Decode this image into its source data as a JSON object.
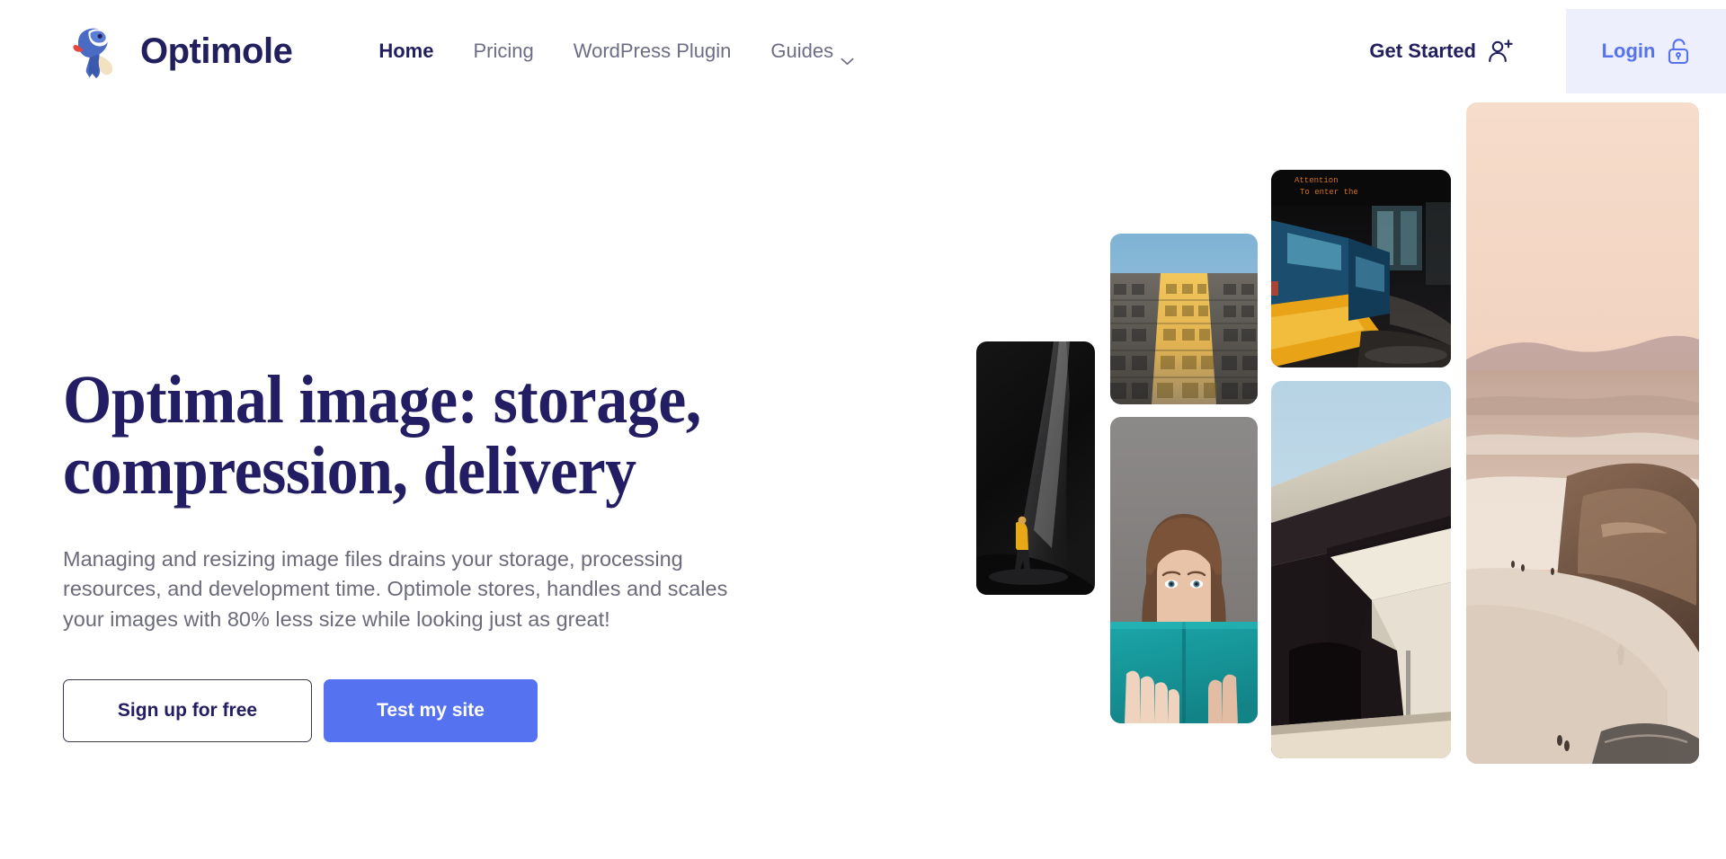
{
  "brand": {
    "name": "Optimole",
    "logo_icon": "optimole-mole-logo",
    "navy": "#221F5E",
    "blue": "#5572F0",
    "lavender": "#EDEFFC"
  },
  "nav": {
    "items": [
      {
        "label": "Home",
        "active": true,
        "has_dropdown": false
      },
      {
        "label": "Pricing",
        "active": false,
        "has_dropdown": false
      },
      {
        "label": "WordPress Plugin",
        "active": false,
        "has_dropdown": false
      },
      {
        "label": "Guides",
        "active": false,
        "has_dropdown": true,
        "dropdown_icon": "chevron-down-icon"
      }
    ]
  },
  "header_actions": {
    "get_started_label": "Get Started",
    "get_started_icon": "user-plus-icon",
    "login_label": "Login",
    "login_icon": "unlock-padlock-icon"
  },
  "hero": {
    "title_line_1": "Optimal image: storage,",
    "title_line_2": "compression, delivery",
    "paragraph": "Managing and resizing image files drains your storage, processing resources, and development time. Optimole stores, handles and scales your images with 80% less size while looking just as great!",
    "primary_cta": "Test my site",
    "secondary_cta": "Sign up for free"
  },
  "collage": {
    "photos": [
      {
        "name": "hiker-in-cave-photo",
        "alt": "Hiker in yellow jacket walking through a dark cave"
      },
      {
        "name": "building-upshot-photo",
        "alt": "Looking up at a tall building with sunlit golden facade against blue sky"
      },
      {
        "name": "woman-with-book-photo",
        "alt": "Woman holding a teal book covering the lower half of her face"
      },
      {
        "name": "train-station-photo",
        "alt": "Blue and yellow train at a dark station platform with destination sign"
      },
      {
        "name": "bridge-underpass-photo",
        "alt": "Concrete bridge underpass architecture against blue sky"
      },
      {
        "name": "coastal-cliff-photo",
        "alt": "Coastal cliffs and beach at sunset with pink sky"
      }
    ]
  }
}
